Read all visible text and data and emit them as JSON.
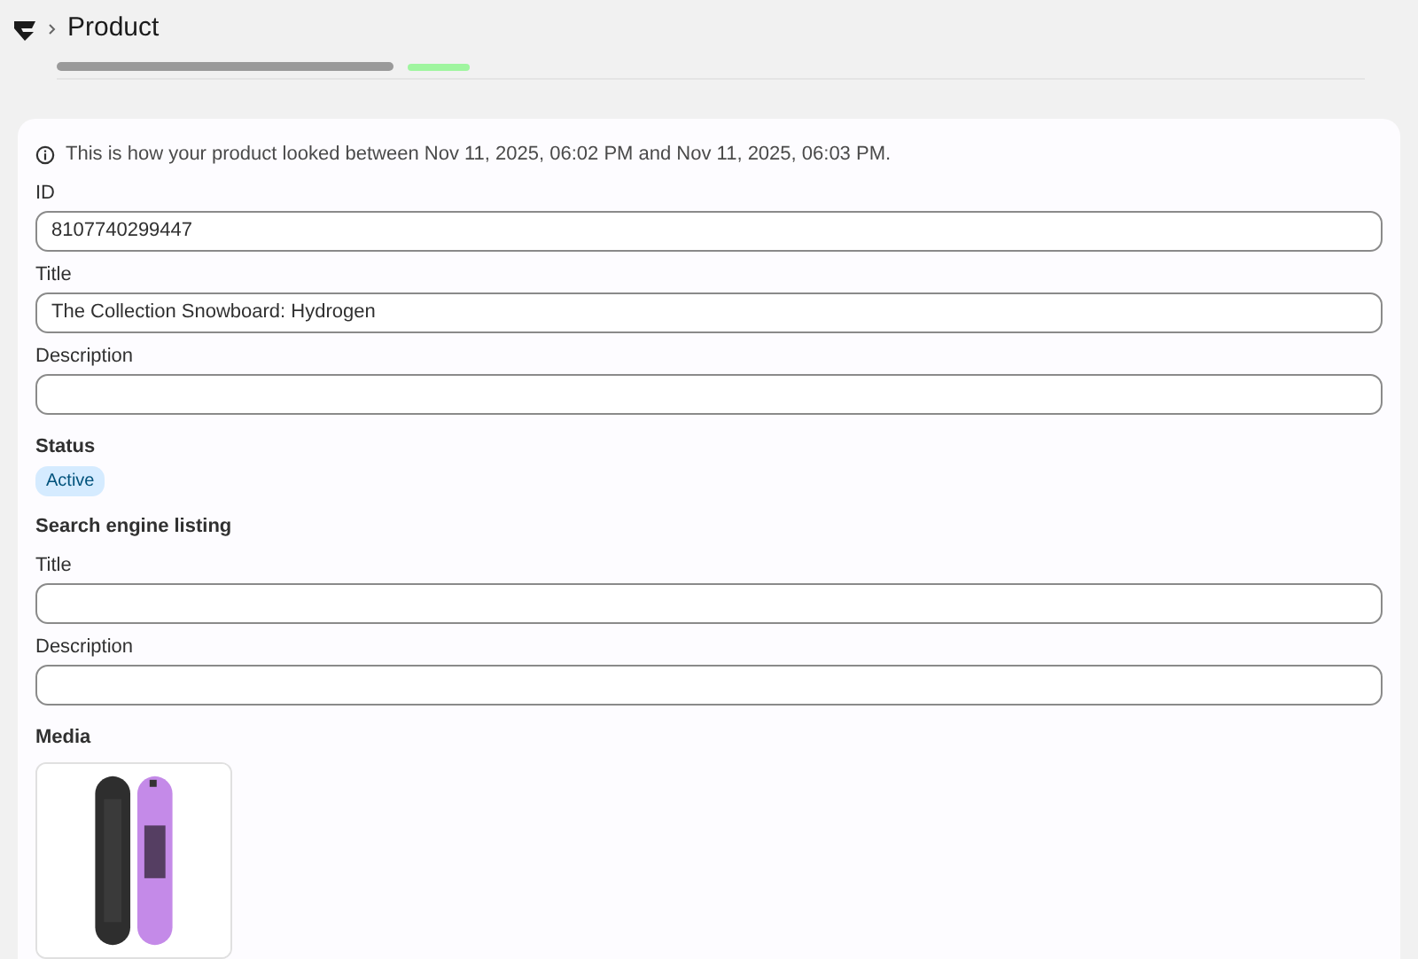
{
  "header": {
    "title": "Product"
  },
  "notice": "This is how your product looked between Nov 11, 2025, 06:02 PM and Nov 11, 2025, 06:03 PM.",
  "fields": [
    {
      "label": "ID",
      "value": "8107740299447"
    },
    {
      "label": "Title",
      "value": "The Collection Snowboard: Hydrogen"
    },
    {
      "label": "Description"
    }
  ],
  "status": {
    "heading": "Status",
    "badge": "Active"
  },
  "seo": {
    "heading": "Search engine listing",
    "fields": [
      {
        "label": "Title"
      },
      {
        "label": "Description"
      }
    ]
  },
  "media": {
    "heading": "Media"
  }
}
